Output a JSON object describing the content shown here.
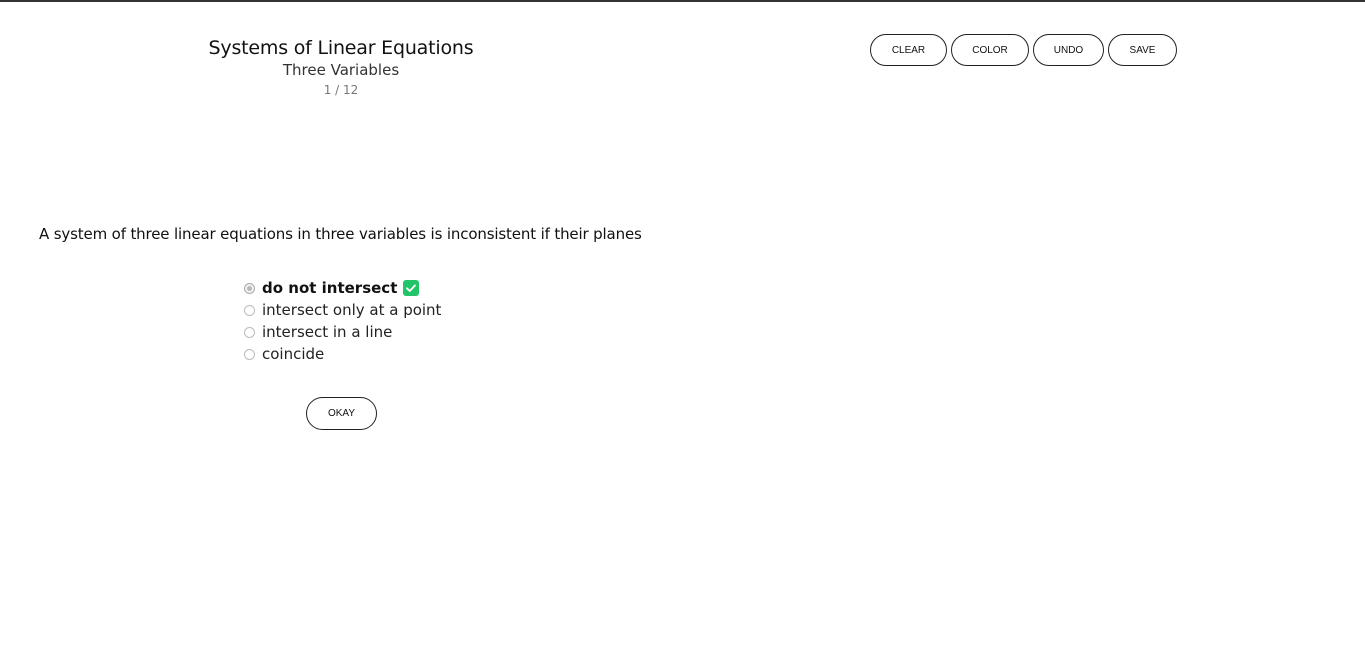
{
  "header": {
    "title": "Systems of Linear Equations",
    "subtitle": "Three Variables",
    "counter": "1 / 12"
  },
  "toolbar": {
    "clear_label": "CLEAR",
    "color_label": "COLOR",
    "undo_label": "UNDO",
    "save_label": "SAVE"
  },
  "question": {
    "text": "A system of three linear equations in three variables is inconsistent if their planes",
    "options": [
      {
        "label": "do not intersect",
        "selected": true,
        "correct": true
      },
      {
        "label": "intersect only at a point",
        "selected": false
      },
      {
        "label": "intersect in a line",
        "selected": false
      },
      {
        "label": "coincide",
        "selected": false
      }
    ],
    "correct_icon": "check-icon",
    "correct_color": "#22c46a"
  },
  "actions": {
    "okay_label": "OKAY"
  }
}
